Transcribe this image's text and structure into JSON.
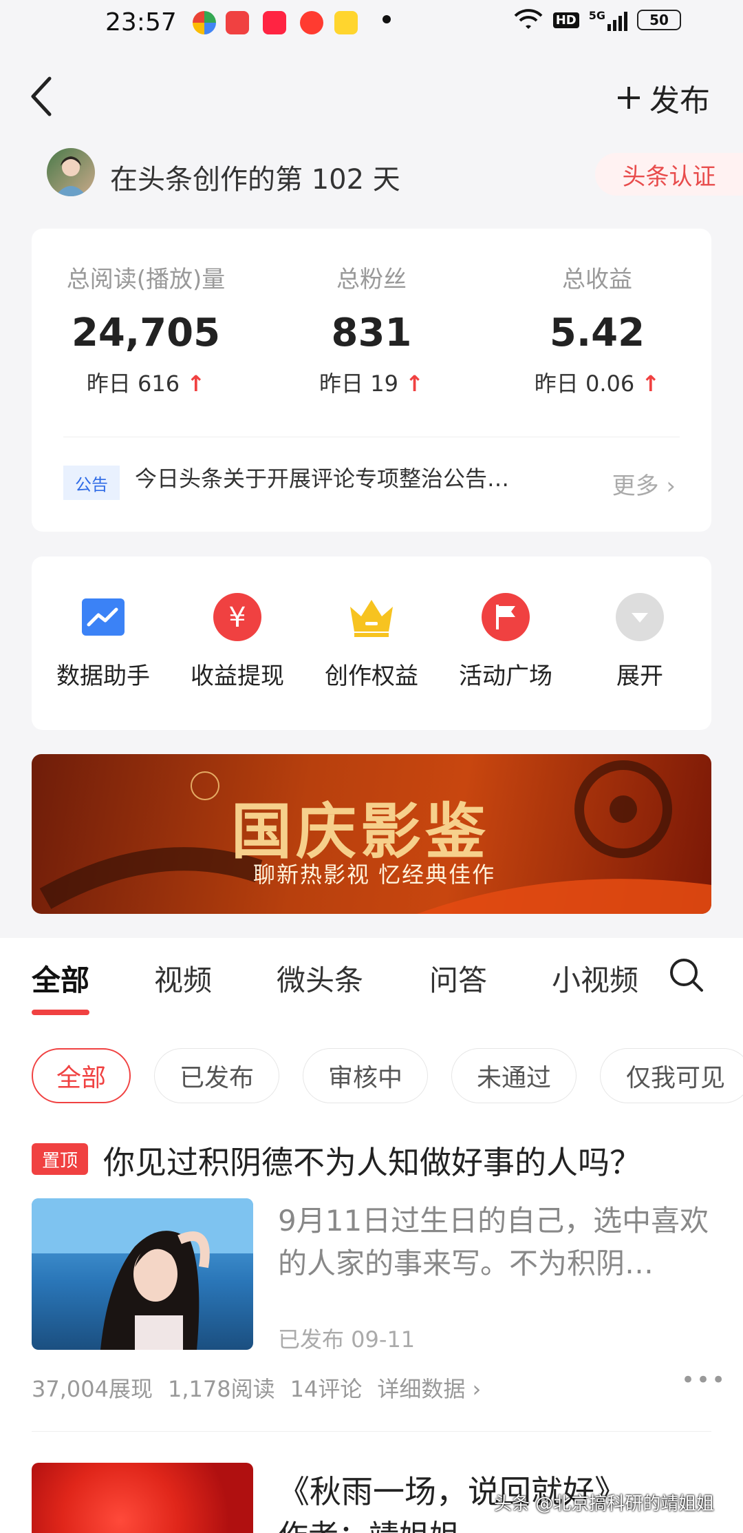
{
  "status_bar": {
    "time": "23:57",
    "network": "5G",
    "hd": "HD",
    "battery": "50",
    "notification_icons": [
      "maps-icon",
      "toutiao-icon",
      "xiaohongshu-icon",
      "video-icon",
      "notes-icon"
    ]
  },
  "header": {
    "publish_label": "发布",
    "days_text": "在头条创作的第 102 天",
    "cert_label": "头条认证"
  },
  "stats": [
    {
      "label": "总阅读(播放)量",
      "value": "24,705",
      "yesterday": "昨日 616"
    },
    {
      "label": "总粉丝",
      "value": "831",
      "yesterday": "昨日 19"
    },
    {
      "label": "总收益",
      "value": "5.42",
      "yesterday": "昨日 0.06"
    }
  ],
  "notice": {
    "tag": "公告",
    "text": "今日头条关于开展评论专项整治公告…",
    "more_label": "更多"
  },
  "tools": [
    {
      "label": "数据助手",
      "icon": "chart-icon",
      "color": "#3b82f6"
    },
    {
      "label": "收益提现",
      "icon": "yuan-icon",
      "color": "#f04141"
    },
    {
      "label": "创作权益",
      "icon": "crown-icon",
      "color": "#f7c320"
    },
    {
      "label": "活动广场",
      "icon": "flag-icon",
      "color": "#f04141"
    },
    {
      "label": "展开",
      "icon": "expand-icon",
      "color": "#dddddd"
    }
  ],
  "banner": {
    "title": "国庆影鉴",
    "subtitle": "聊新热影视  忆经典佳作"
  },
  "tabs": [
    "全部",
    "视频",
    "微头条",
    "问答",
    "小视频"
  ],
  "filters": [
    "全部",
    "已发布",
    "审核中",
    "未通过",
    "仅我可见"
  ],
  "articles": [
    {
      "pin_label": "置顶",
      "title": "你见过积阴德不为人知做好事的人吗？",
      "summary": "9月11日过生日的自己，选中喜欢的人家的事来写。不为积阴…",
      "status": "已发布   09-11",
      "impressions": "37,004展现",
      "reads": "1,178阅读",
      "comments": "14评论",
      "detail_label": "详细数据"
    },
    {
      "title": "《秋雨一场，说回就好》",
      "author": "作者：靖姐姐"
    }
  ],
  "watermark": "头条 @北京搞科研的靖姐姐"
}
